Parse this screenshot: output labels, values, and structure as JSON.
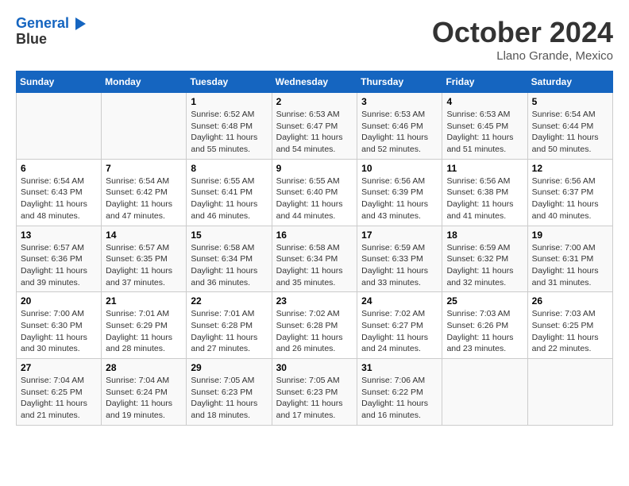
{
  "logo": {
    "line1": "General",
    "line2": "Blue"
  },
  "title": "October 2024",
  "location": "Llano Grande, Mexico",
  "days_of_week": [
    "Sunday",
    "Monday",
    "Tuesday",
    "Wednesday",
    "Thursday",
    "Friday",
    "Saturday"
  ],
  "weeks": [
    [
      {
        "day": "",
        "sunrise": "",
        "sunset": "",
        "daylight": ""
      },
      {
        "day": "",
        "sunrise": "",
        "sunset": "",
        "daylight": ""
      },
      {
        "day": "1",
        "sunrise": "Sunrise: 6:52 AM",
        "sunset": "Sunset: 6:48 PM",
        "daylight": "Daylight: 11 hours and 55 minutes."
      },
      {
        "day": "2",
        "sunrise": "Sunrise: 6:53 AM",
        "sunset": "Sunset: 6:47 PM",
        "daylight": "Daylight: 11 hours and 54 minutes."
      },
      {
        "day": "3",
        "sunrise": "Sunrise: 6:53 AM",
        "sunset": "Sunset: 6:46 PM",
        "daylight": "Daylight: 11 hours and 52 minutes."
      },
      {
        "day": "4",
        "sunrise": "Sunrise: 6:53 AM",
        "sunset": "Sunset: 6:45 PM",
        "daylight": "Daylight: 11 hours and 51 minutes."
      },
      {
        "day": "5",
        "sunrise": "Sunrise: 6:54 AM",
        "sunset": "Sunset: 6:44 PM",
        "daylight": "Daylight: 11 hours and 50 minutes."
      }
    ],
    [
      {
        "day": "6",
        "sunrise": "Sunrise: 6:54 AM",
        "sunset": "Sunset: 6:43 PM",
        "daylight": "Daylight: 11 hours and 48 minutes."
      },
      {
        "day": "7",
        "sunrise": "Sunrise: 6:54 AM",
        "sunset": "Sunset: 6:42 PM",
        "daylight": "Daylight: 11 hours and 47 minutes."
      },
      {
        "day": "8",
        "sunrise": "Sunrise: 6:55 AM",
        "sunset": "Sunset: 6:41 PM",
        "daylight": "Daylight: 11 hours and 46 minutes."
      },
      {
        "day": "9",
        "sunrise": "Sunrise: 6:55 AM",
        "sunset": "Sunset: 6:40 PM",
        "daylight": "Daylight: 11 hours and 44 minutes."
      },
      {
        "day": "10",
        "sunrise": "Sunrise: 6:56 AM",
        "sunset": "Sunset: 6:39 PM",
        "daylight": "Daylight: 11 hours and 43 minutes."
      },
      {
        "day": "11",
        "sunrise": "Sunrise: 6:56 AM",
        "sunset": "Sunset: 6:38 PM",
        "daylight": "Daylight: 11 hours and 41 minutes."
      },
      {
        "day": "12",
        "sunrise": "Sunrise: 6:56 AM",
        "sunset": "Sunset: 6:37 PM",
        "daylight": "Daylight: 11 hours and 40 minutes."
      }
    ],
    [
      {
        "day": "13",
        "sunrise": "Sunrise: 6:57 AM",
        "sunset": "Sunset: 6:36 PM",
        "daylight": "Daylight: 11 hours and 39 minutes."
      },
      {
        "day": "14",
        "sunrise": "Sunrise: 6:57 AM",
        "sunset": "Sunset: 6:35 PM",
        "daylight": "Daylight: 11 hours and 37 minutes."
      },
      {
        "day": "15",
        "sunrise": "Sunrise: 6:58 AM",
        "sunset": "Sunset: 6:34 PM",
        "daylight": "Daylight: 11 hours and 36 minutes."
      },
      {
        "day": "16",
        "sunrise": "Sunrise: 6:58 AM",
        "sunset": "Sunset: 6:34 PM",
        "daylight": "Daylight: 11 hours and 35 minutes."
      },
      {
        "day": "17",
        "sunrise": "Sunrise: 6:59 AM",
        "sunset": "Sunset: 6:33 PM",
        "daylight": "Daylight: 11 hours and 33 minutes."
      },
      {
        "day": "18",
        "sunrise": "Sunrise: 6:59 AM",
        "sunset": "Sunset: 6:32 PM",
        "daylight": "Daylight: 11 hours and 32 minutes."
      },
      {
        "day": "19",
        "sunrise": "Sunrise: 7:00 AM",
        "sunset": "Sunset: 6:31 PM",
        "daylight": "Daylight: 11 hours and 31 minutes."
      }
    ],
    [
      {
        "day": "20",
        "sunrise": "Sunrise: 7:00 AM",
        "sunset": "Sunset: 6:30 PM",
        "daylight": "Daylight: 11 hours and 30 minutes."
      },
      {
        "day": "21",
        "sunrise": "Sunrise: 7:01 AM",
        "sunset": "Sunset: 6:29 PM",
        "daylight": "Daylight: 11 hours and 28 minutes."
      },
      {
        "day": "22",
        "sunrise": "Sunrise: 7:01 AM",
        "sunset": "Sunset: 6:28 PM",
        "daylight": "Daylight: 11 hours and 27 minutes."
      },
      {
        "day": "23",
        "sunrise": "Sunrise: 7:02 AM",
        "sunset": "Sunset: 6:28 PM",
        "daylight": "Daylight: 11 hours and 26 minutes."
      },
      {
        "day": "24",
        "sunrise": "Sunrise: 7:02 AM",
        "sunset": "Sunset: 6:27 PM",
        "daylight": "Daylight: 11 hours and 24 minutes."
      },
      {
        "day": "25",
        "sunrise": "Sunrise: 7:03 AM",
        "sunset": "Sunset: 6:26 PM",
        "daylight": "Daylight: 11 hours and 23 minutes."
      },
      {
        "day": "26",
        "sunrise": "Sunrise: 7:03 AM",
        "sunset": "Sunset: 6:25 PM",
        "daylight": "Daylight: 11 hours and 22 minutes."
      }
    ],
    [
      {
        "day": "27",
        "sunrise": "Sunrise: 7:04 AM",
        "sunset": "Sunset: 6:25 PM",
        "daylight": "Daylight: 11 hours and 21 minutes."
      },
      {
        "day": "28",
        "sunrise": "Sunrise: 7:04 AM",
        "sunset": "Sunset: 6:24 PM",
        "daylight": "Daylight: 11 hours and 19 minutes."
      },
      {
        "day": "29",
        "sunrise": "Sunrise: 7:05 AM",
        "sunset": "Sunset: 6:23 PM",
        "daylight": "Daylight: 11 hours and 18 minutes."
      },
      {
        "day": "30",
        "sunrise": "Sunrise: 7:05 AM",
        "sunset": "Sunset: 6:23 PM",
        "daylight": "Daylight: 11 hours and 17 minutes."
      },
      {
        "day": "31",
        "sunrise": "Sunrise: 7:06 AM",
        "sunset": "Sunset: 6:22 PM",
        "daylight": "Daylight: 11 hours and 16 minutes."
      },
      {
        "day": "",
        "sunrise": "",
        "sunset": "",
        "daylight": ""
      },
      {
        "day": "",
        "sunrise": "",
        "sunset": "",
        "daylight": ""
      }
    ]
  ]
}
